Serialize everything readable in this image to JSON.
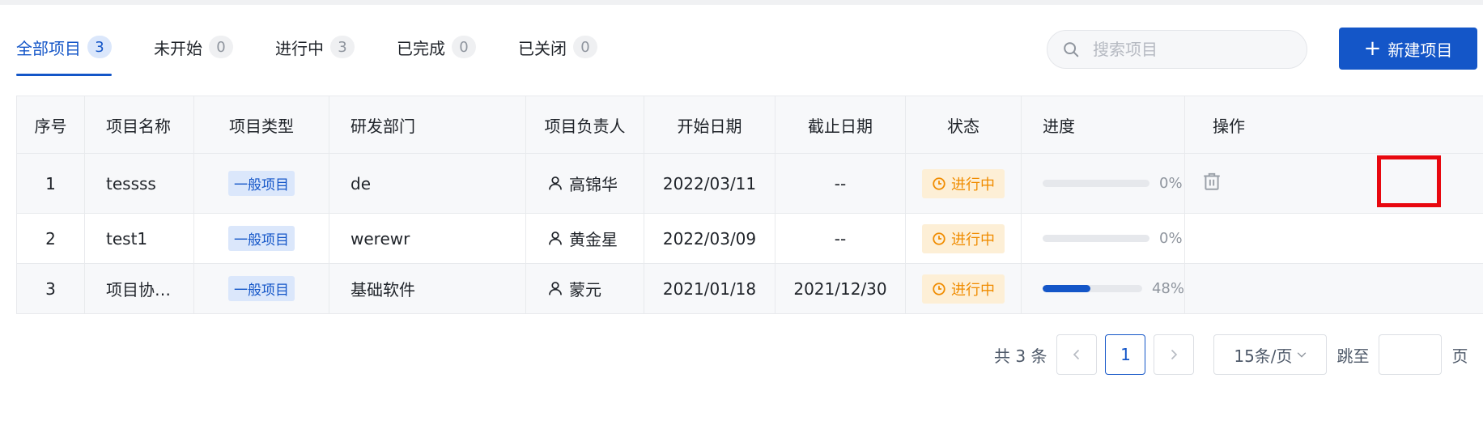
{
  "tabs": [
    {
      "label": "全部项目",
      "count": "3"
    },
    {
      "label": "未开始",
      "count": "0"
    },
    {
      "label": "进行中",
      "count": "3"
    },
    {
      "label": "已完成",
      "count": "0"
    },
    {
      "label": "已关闭",
      "count": "0"
    }
  ],
  "search": {
    "placeholder": "搜索项目"
  },
  "toolbar": {
    "new_label": "新建项目",
    "new_icon": "plus-icon"
  },
  "table": {
    "headers": [
      "序号",
      "项目名称",
      "项目类型",
      "研发部门",
      "项目负责人",
      "开始日期",
      "截止日期",
      "状态",
      "进度",
      "操作"
    ],
    "rows": [
      {
        "index": "1",
        "name": "tessss",
        "type": "一般项目",
        "dept": "de",
        "owner": "高锦华",
        "start": "2022/03/11",
        "end": "--",
        "status": "进行中",
        "progress": 0,
        "progress_text": "0%"
      },
      {
        "index": "2",
        "name": "test1",
        "type": "一般项目",
        "dept": "werewr",
        "owner": "黄金星",
        "start": "2022/03/09",
        "end": "--",
        "status": "进行中",
        "progress": 0,
        "progress_text": "0%"
      },
      {
        "index": "3",
        "name": "项目协…",
        "type": "一般项目",
        "dept": "基础软件",
        "owner": "蒙元",
        "start": "2021/01/18",
        "end": "2021/12/30",
        "status": "进行中",
        "progress": 48,
        "progress_text": "48%"
      }
    ]
  },
  "pagination": {
    "total": "共 3 条",
    "current": "1",
    "page_size": "15条/页",
    "jump_label": "跳至",
    "page_suffix": "页"
  },
  "colors": {
    "primary": "#1456c8",
    "status_bg": "#fdefd6",
    "status_fg": "#f08c00",
    "highlight": "#e8080f"
  }
}
